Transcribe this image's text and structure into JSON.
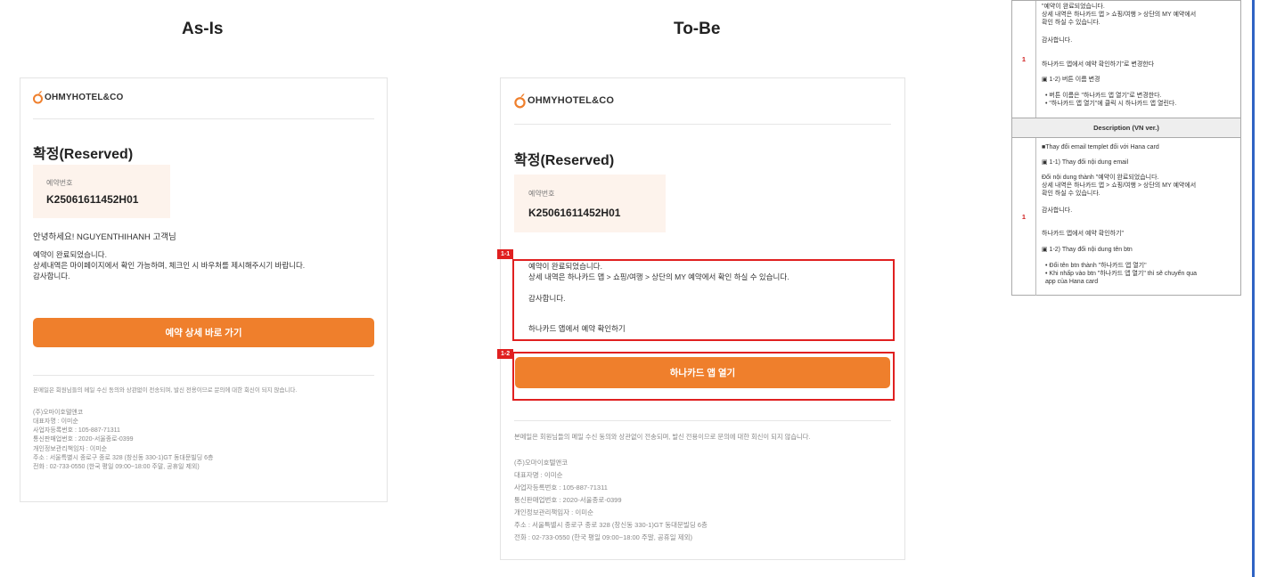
{
  "headings": {
    "asis": "As-Is",
    "tobe": "To-Be"
  },
  "logo": {
    "text": "OHMYHOTEL&CO"
  },
  "email": {
    "title": "확정(Reserved)",
    "res_label": "예약번호",
    "res_number": "K25061611452H01",
    "footer": [
      "본메일은 회원님들의 메일 수신 동의와 상관없이 전송되며, 발신 전용이므로 문의에 대한 회신이 되지 않습니다.",
      "(주)오마이호텔앤코",
      "대표자명 : 이미순",
      "사업자등록번호 : 105-887-71311",
      "통신판매업번호 : 2020-서울종로-0399",
      "개인정보관리책임자 : 이미순",
      "주소 : 서울특별시 종로구 종로 328 (창신동 330-1)GT 동대문빌딩 6층",
      "전화 : 02-733-0550 (한국 평일 09:00~18:00 주말, 공휴일 제외)"
    ]
  },
  "asis": {
    "greeting": "안녕하세요! NGUYENTHIHANH 고객님",
    "body": [
      "예약이 완료되었습니다.",
      "상세내역은 마이페이지에서 확인 가능하며, 체크인 시 바우처를 제시해주시기 바랍니다.",
      "감사합니다."
    ],
    "button": "예약 상세 바로 가기"
  },
  "tobe": {
    "tag1": "1-1",
    "tag2": "1-2",
    "body": [
      "예약이 완료되었습니다.",
      "상세 내역은 하나카드 앱 > 쇼핑/여행 > 상단의 MY 예약에서 확인 하실 수 있습니다.",
      "감사합니다.",
      "하나카드 앱에서 예약 확인하기"
    ],
    "button": "하나카드 앱 열기"
  },
  "panel": {
    "num": "1",
    "kr_lines": [
      "\"예약이 완료되었습니다.",
      "상세 내역은 하나카드 앱 > 쇼핑/여행 > 상단의 MY 예약에서",
      "확인 하실 수 있습니다.",
      "감사합니다.",
      "하나카드 앱에서 예약 확인하기\"로 변경한다",
      "▣ 1-2) 버튼 이름 변경",
      "• 버튼 이름은 \"하나카드 앱 열기\"로 변경한다.",
      "• \"하나카드 앱 열기\"에 클릭 시 하나카드 앱 열린다."
    ],
    "vn_header": "Description (VN ver.)",
    "vn_lines": [
      "■Thay đổi email templet đối với Hana card",
      "▣ 1-1) Thay đổi nội dung email",
      "Đổi nội dung thành \"예약이 완료되었습니다.",
      "상세 내역은 하나카드 앱 > 쇼핑/여행 > 상단의 MY 예약에서",
      "확인 하실 수 있습니다.",
      "감사합니다.",
      "하나카드 앱에서 예약 확인하기\"",
      "▣ 1-2) Thay đổi nội dung tên btn",
      "• Đổi tên btn thành \"하나카드 앱 열기\"",
      "• Khi nhấp vào btn \"하나카드 앱 열기\" thì sẽ chuyển qua",
      "  app của Hana card"
    ]
  },
  "colors": {
    "accent": "#ef7f2c",
    "highlight": "#e02020",
    "res_bg": "#fdf3ec"
  }
}
